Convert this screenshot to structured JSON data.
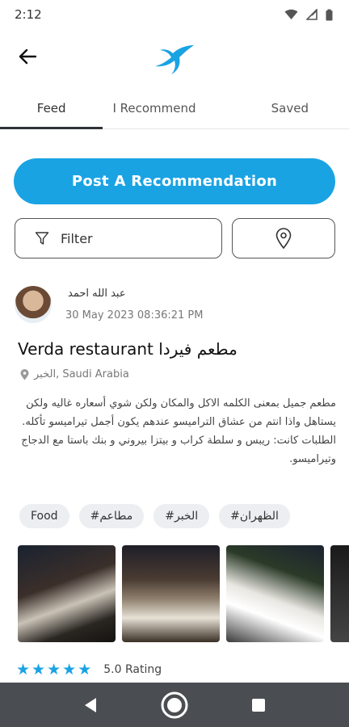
{
  "status_bar": {
    "time": "2:12",
    "icons": [
      "wifi-icon",
      "signal-icon",
      "battery-icon"
    ]
  },
  "header": {
    "back_icon": "arrow-left-icon",
    "logo_icon": "bird-logo-icon"
  },
  "tabs": [
    {
      "label": "Feed",
      "active": true
    },
    {
      "label": "I Recommend",
      "active": false
    },
    {
      "label": "Saved",
      "active": false
    }
  ],
  "actions": {
    "post_label": "Post A Recommendation",
    "filter_label": "Filter",
    "filter_icon": "funnel-icon",
    "location_icon": "map-pin-icon"
  },
  "post": {
    "author": "عبد الله احمد",
    "date": "30 May 2023 08:36:21 PM",
    "title": "Verda restaurant مطعم فيردا",
    "location": "الخبر, Saudi Arabia",
    "description_lines": [
      "مطعم جميل بمعنى الكلمه الاكل والمكان ولكن شوي أسعاره غاليه ولكن يستاهل واذا انتم من عشاق التراميسو عندهم يكون أجمل تيراميسو تأكله.",
      "الطلبات كانت: ريبس و سلطة كراب و بيتزا بيروني و بنك باستا مع الدجاج وتيراميسو."
    ],
    "tags": [
      "Food",
      "#مطاعم",
      "#الخبر",
      "#الظهران"
    ],
    "photo_count": 4,
    "rating_value": 5,
    "rating_label": "5.0 Rating"
  },
  "nav_bar": {
    "icons": [
      "back-triangle-icon",
      "home-circle-icon",
      "recents-square-icon"
    ]
  },
  "colors": {
    "accent": "#1aa3e3",
    "nav_bg": "#4a4d51",
    "tag_bg": "#eceef1"
  }
}
